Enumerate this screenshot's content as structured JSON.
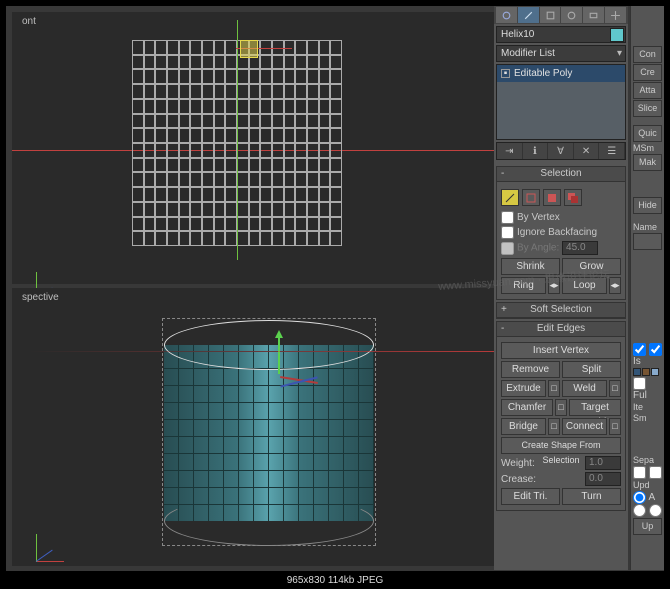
{
  "viewport": {
    "top_label": "ont",
    "bottom_label": "spective"
  },
  "watermark": "www.missyuan.com · 思缘设计论坛",
  "footer": "965x830   114kb   JPEG",
  "modify": {
    "object_name": "Helix10",
    "dropdown": "Modifier List",
    "stack_item": "Editable Poly",
    "object_color": "#60c8cc"
  },
  "selection": {
    "title": "Selection",
    "by_vertex": "By Vertex",
    "ignore_backfacing": "Ignore Backfacing",
    "by_angle": "By Angle:",
    "by_angle_val": "45.0",
    "shrink": "Shrink",
    "grow": "Grow",
    "ring": "Ring",
    "loop": "Loop"
  },
  "soft_selection": {
    "title": "Soft Selection"
  },
  "edit_edges": {
    "title": "Edit Edges",
    "insert_vertex": "Insert Vertex",
    "remove": "Remove",
    "split": "Split",
    "extrude": "Extrude",
    "weld": "Weld",
    "chamfer": "Chamfer",
    "target_weld": "Target Weld",
    "bridge": "Bridge",
    "connect": "Connect",
    "create_shape": "Create Shape From Selection",
    "weight_label": "Weight:",
    "weight_val": "1.0",
    "crease_label": "Crease:",
    "crease_val": "0.0",
    "edit_tri": "Edit Tri.",
    "turn": "Turn"
  },
  "side2": {
    "con_btn": "Con",
    "cre_btn": "Cre",
    "att_btn": "Atta",
    "slice_btn": "Slice",
    "quick_btn": "Quic",
    "msm_btn": "MSm",
    "mak_btn": "Mak",
    "hide_btn": "Hide",
    "name_lbl": "Name",
    "is_lbl": "Is",
    "full_lbl": "Ful",
    "iter_lbl": "Ite",
    "smooth_lbl": "Sm",
    "sep_lbl": "Sepa",
    "upd_lbl": "Upd",
    "a_lbl": "A",
    "update_btn": "Up"
  }
}
